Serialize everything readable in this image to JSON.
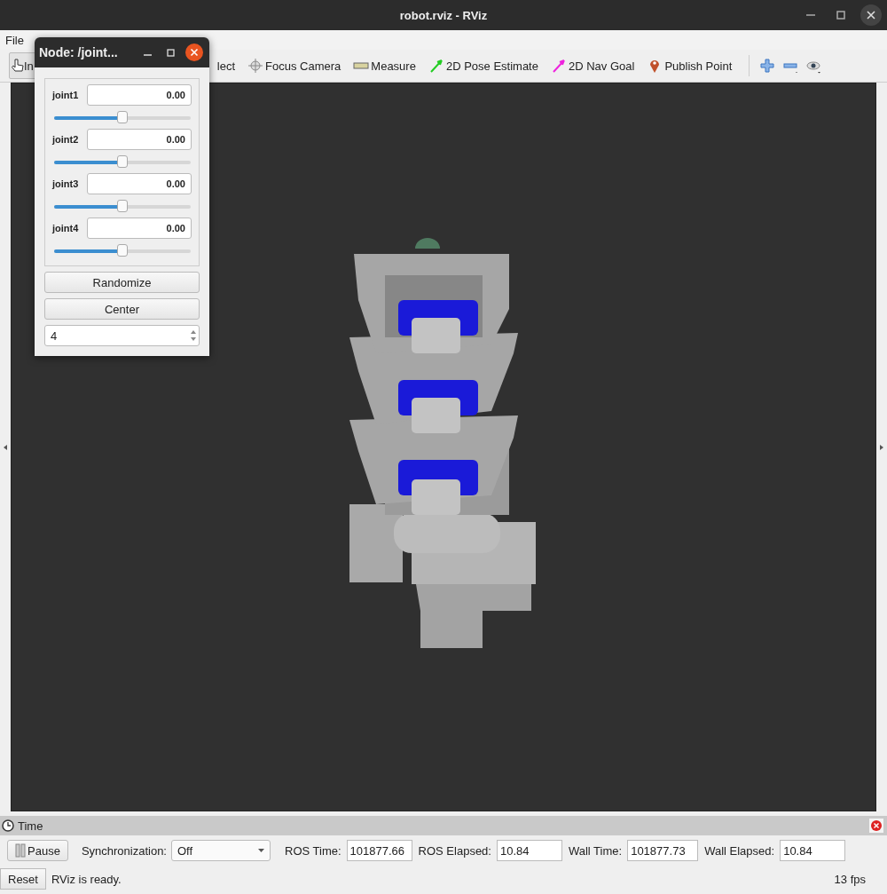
{
  "window": {
    "title": "robot.rviz - RViz"
  },
  "menu": [
    {
      "label": "File"
    }
  ],
  "toolbar": [
    {
      "kind": "interact",
      "label": "In",
      "selected": true
    },
    {
      "kind": "select",
      "label": "lect",
      "selected": false
    },
    {
      "kind": "focus",
      "label": "Focus Camera",
      "selected": false
    },
    {
      "kind": "measure",
      "label": "Measure",
      "selected": false
    },
    {
      "kind": "pose",
      "label": "2D Pose Estimate",
      "selected": false
    },
    {
      "kind": "nav",
      "label": "2D Nav Goal",
      "selected": false
    },
    {
      "kind": "point",
      "label": "Publish Point",
      "selected": false
    }
  ],
  "dialog": {
    "title": "Node: /joint...",
    "joints": [
      {
        "name": "joint1",
        "value": "0.00",
        "level": 0.5
      },
      {
        "name": "joint2",
        "value": "0.00",
        "level": 0.5
      },
      {
        "name": "joint3",
        "value": "0.00",
        "level": 0.5
      },
      {
        "name": "joint4",
        "value": "0.00",
        "level": 0.5
      }
    ],
    "buttons": [
      "Randomize",
      "Center"
    ],
    "spinbox": {
      "value": "4"
    }
  },
  "time_panel": {
    "title": "Time",
    "pause_button": "Pause",
    "sync_label": "Synchronization:",
    "sync_value": "Off",
    "fields": [
      {
        "label": "ROS Time:",
        "value": "101877.66"
      },
      {
        "label": "ROS Elapsed:",
        "value": "10.84"
      },
      {
        "label": "Wall Time:",
        "value": "101877.73"
      },
      {
        "label": "Wall Elapsed:",
        "value": "10.84"
      }
    ]
  },
  "status_bar": {
    "reset_button": "Reset",
    "message": "RViz is ready.",
    "fps": "13 fps"
  }
}
